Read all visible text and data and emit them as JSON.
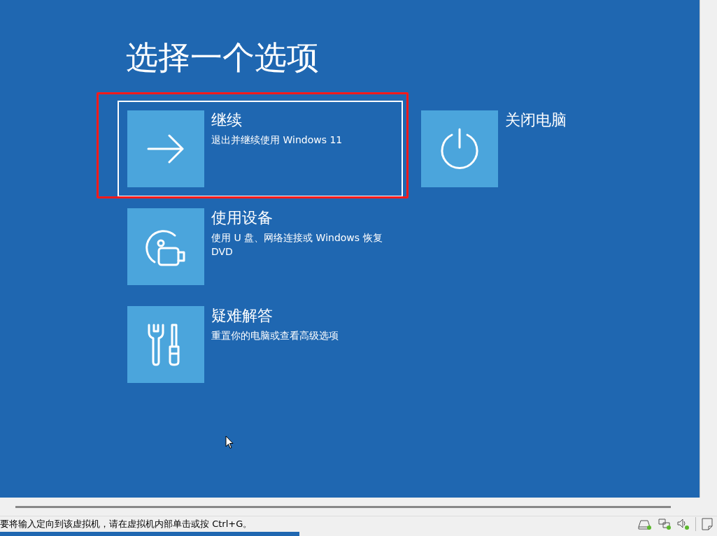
{
  "title": "选择一个选项",
  "options": [
    {
      "kind": "arrow",
      "heading": "继续",
      "description": "退出并继续使用 Windows 11",
      "selected": true,
      "annotated": true
    },
    {
      "kind": "device",
      "heading": "使用设备",
      "description": "使用 U 盘、网络连接或 Windows 恢复 DVD",
      "selected": false,
      "annotated": false
    },
    {
      "kind": "tools",
      "heading": "疑难解答",
      "description": "重置你的电脑或查看高级选项",
      "selected": false,
      "annotated": false
    }
  ],
  "side_options": [
    {
      "kind": "power",
      "heading": "关闭电脑",
      "selected": false,
      "annotated": false
    }
  ],
  "status_bar": {
    "message": "要将输入定向到该虚拟机，请在虚拟机内部单击或按 Ctrl+G。"
  }
}
